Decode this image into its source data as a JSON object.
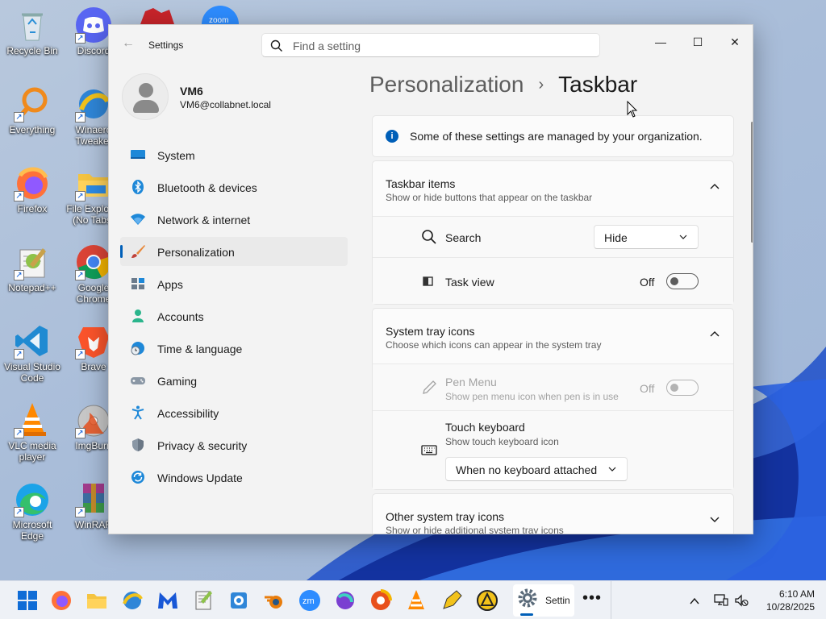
{
  "desktop": {
    "icons": [
      {
        "label": "Recycle Bin",
        "icon": "recycle-bin-icon"
      },
      {
        "label": "Discord",
        "icon": "discord-icon"
      },
      {
        "label": "Everything",
        "icon": "everything-search-icon"
      },
      {
        "label": "Winaero\nTweaker",
        "icon": "winaero-tweaker-icon"
      },
      {
        "label": "Firefox",
        "icon": "firefox-icon"
      },
      {
        "label": "File Explorer\n(No Tabs)",
        "icon": "file-explorer-icon"
      },
      {
        "label": "Notepad++",
        "icon": "notepad-plus-plus-icon"
      },
      {
        "label": "Google\nChrome",
        "icon": "chrome-icon"
      },
      {
        "label": "Visual Studio\nCode",
        "icon": "vscode-icon"
      },
      {
        "label": "Brave",
        "icon": "brave-icon"
      },
      {
        "label": "VLC media\nplayer",
        "icon": "vlc-icon"
      },
      {
        "label": "ImgBurn",
        "icon": "imgburn-icon"
      },
      {
        "label": "Microsoft\nEdge",
        "icon": "edge-icon"
      },
      {
        "label": "WinRAR",
        "icon": "winrar-icon"
      }
    ],
    "top_partial": [
      "zoom"
    ]
  },
  "window": {
    "app_title": "Settings",
    "search_placeholder": "Find a setting",
    "controls": {
      "minimize": "—",
      "maximize": "☐",
      "close": "✕"
    }
  },
  "profile": {
    "name": "VM6",
    "email": "VM6@collabnet.local"
  },
  "nav": {
    "items": [
      {
        "label": "System",
        "icon": "system-display-icon"
      },
      {
        "label": "Bluetooth & devices",
        "icon": "bluetooth-icon"
      },
      {
        "label": "Network & internet",
        "icon": "wifi-icon"
      },
      {
        "label": "Personalization",
        "icon": "brush-icon",
        "active": true
      },
      {
        "label": "Apps",
        "icon": "apps-icon"
      },
      {
        "label": "Accounts",
        "icon": "accounts-icon"
      },
      {
        "label": "Time & language",
        "icon": "globe-clock-icon"
      },
      {
        "label": "Gaming",
        "icon": "gamepad-icon"
      },
      {
        "label": "Accessibility",
        "icon": "accessibility-icon"
      },
      {
        "label": "Privacy & security",
        "icon": "shield-icon"
      },
      {
        "label": "Windows Update",
        "icon": "windows-update-icon"
      }
    ]
  },
  "breadcrumb": {
    "parent": "Personalization",
    "separator": "›",
    "current": "Taskbar"
  },
  "notice": {
    "text": "Some of these settings are managed by your organization."
  },
  "taskbar_items": {
    "title": "Taskbar items",
    "subtitle": "Show or hide buttons that appear on the taskbar",
    "search": {
      "label": "Search",
      "value": "Hide"
    },
    "task_view": {
      "label": "Task view",
      "state": "Off"
    }
  },
  "system_tray": {
    "title": "System tray icons",
    "subtitle": "Choose which icons can appear in the system tray",
    "pen_menu": {
      "label": "Pen Menu",
      "sub": "Show pen menu icon when pen is in use",
      "state": "Off",
      "disabled": true
    },
    "touch_keyboard": {
      "label": "Touch keyboard",
      "sub": "Show touch keyboard icon",
      "value": "When no keyboard attached"
    }
  },
  "other_tray": {
    "title": "Other system tray icons",
    "subtitle": "Show or hide additional system tray icons"
  },
  "taskbar": {
    "settings_label": "Settin",
    "time": "6:10 AM",
    "date": "10/28/2025",
    "more": "•••"
  },
  "colors": {
    "accent": "#005fb8",
    "window_bg": "#f3f3f3",
    "card_bg": "#fbfbfb"
  }
}
